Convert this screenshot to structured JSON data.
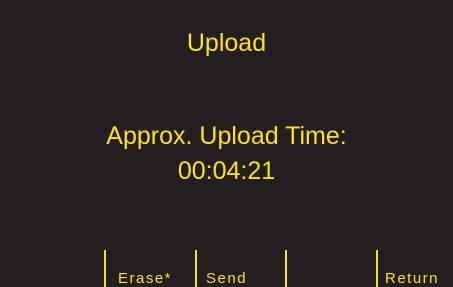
{
  "screen": {
    "title": "Upload",
    "upload_time_label": "Approx. Upload Time:",
    "upload_time_value": "00:04:21"
  },
  "softkeys": {
    "key1": "Erase*",
    "key2": "Send",
    "key3": "",
    "key4": "Return"
  },
  "colors": {
    "background": "#231f20",
    "text": "#ffe01a"
  }
}
